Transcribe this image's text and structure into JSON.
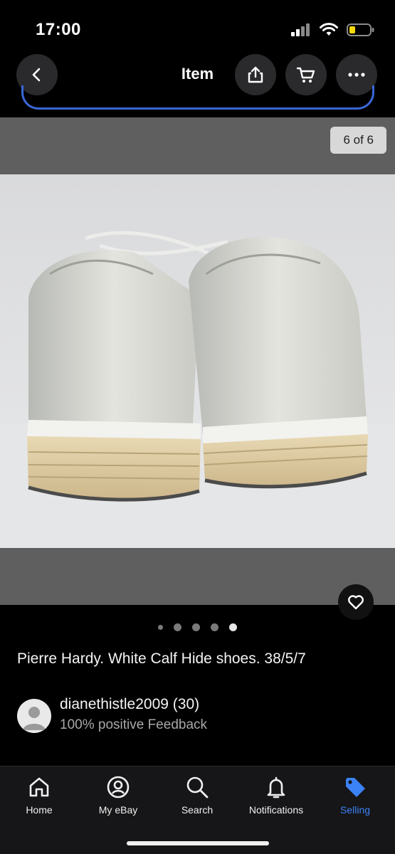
{
  "status": {
    "time": "17:00"
  },
  "nav": {
    "title": "Item",
    "back_icon": "chevron-left-icon",
    "share_icon": "share-icon",
    "cart_icon": "cart-icon",
    "more_icon": "more-horizontal-icon"
  },
  "gallery": {
    "counter": "6 of 6",
    "total_images": 6,
    "current_image": 6,
    "watch_icon": "heart-icon"
  },
  "item": {
    "title": "Pierre Hardy. White Calf Hide shoes.  38/5/7"
  },
  "seller": {
    "name": "dianethistle2009 (30)",
    "feedback": "100% positive Feedback"
  },
  "tabs": [
    {
      "label": "Home",
      "icon": "home-icon"
    },
    {
      "label": "My eBay",
      "icon": "user-circle-icon"
    },
    {
      "label": "Search",
      "icon": "search-icon"
    },
    {
      "label": "Notifications",
      "icon": "bell-icon"
    },
    {
      "label": "Selling",
      "icon": "tag-icon"
    }
  ],
  "colors": {
    "accent": "#3b82f6",
    "background": "#000000"
  }
}
